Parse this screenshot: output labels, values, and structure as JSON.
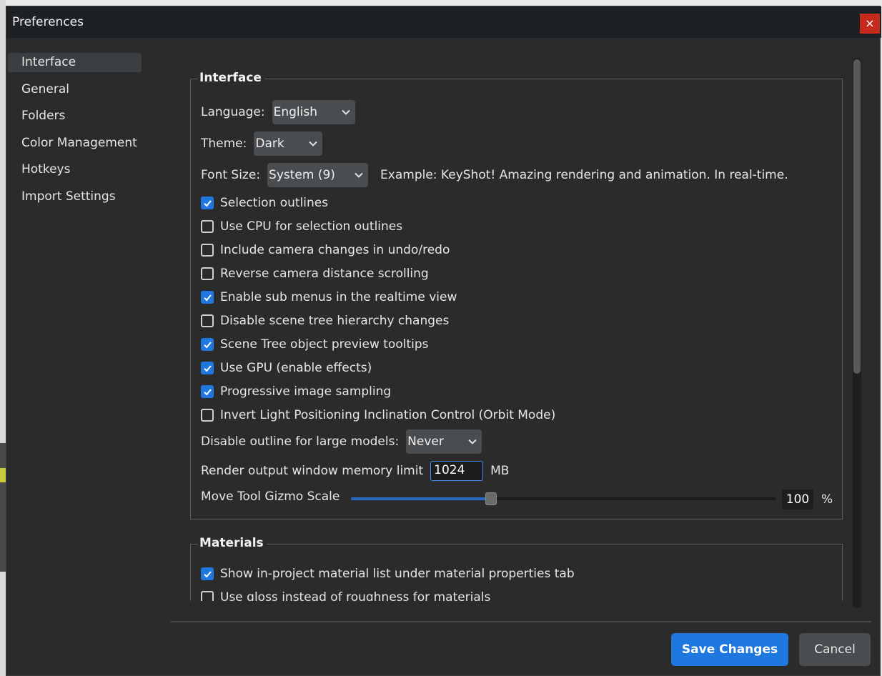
{
  "window": {
    "title": "Preferences",
    "close_glyph": "×"
  },
  "sidebar": {
    "items": [
      {
        "label": "Interface",
        "active": true
      },
      {
        "label": "General"
      },
      {
        "label": "Folders"
      },
      {
        "label": "Color Management"
      },
      {
        "label": "Hotkeys"
      },
      {
        "label": "Import Settings"
      }
    ]
  },
  "interface": {
    "title": "Interface",
    "language": {
      "label": "Language:",
      "value": "English"
    },
    "theme": {
      "label": "Theme:",
      "value": "Dark"
    },
    "font_size": {
      "label": "Font Size:",
      "value": "System (9)",
      "example": "Example: KeyShot! Amazing rendering and animation. In real-time."
    },
    "checkboxes": [
      {
        "label": "Selection outlines",
        "checked": true
      },
      {
        "label": "Use CPU for selection outlines",
        "checked": false
      },
      {
        "label": "Include camera changes in undo/redo",
        "checked": false
      },
      {
        "label": "Reverse camera distance scrolling",
        "checked": false
      },
      {
        "label": "Enable sub menus in the realtime view",
        "checked": true
      },
      {
        "label": "Disable scene tree hierarchy changes",
        "checked": false
      },
      {
        "label": "Scene Tree object preview tooltips",
        "checked": true
      },
      {
        "label": "Use GPU (enable effects)",
        "checked": true
      },
      {
        "label": "Progressive image sampling",
        "checked": true
      },
      {
        "label": "Invert Light Positioning Inclination Control (Orbit Mode)",
        "checked": false
      }
    ],
    "disable_outline": {
      "label": "Disable outline for large models:",
      "value": "Never"
    },
    "memory_limit": {
      "label": "Render output window memory limit",
      "value": "1024",
      "unit": "MB"
    },
    "gizmo_scale": {
      "label": "Move Tool Gizmo Scale",
      "value": "100",
      "unit": "%",
      "fraction": 0.33
    }
  },
  "materials": {
    "title": "Materials",
    "checkboxes": [
      {
        "label": "Show in-project material list under material properties tab",
        "checked": true
      },
      {
        "label": "Use gloss instead of roughness for materials",
        "checked": false
      }
    ]
  },
  "footer": {
    "save_label": "Save Changes",
    "cancel_label": "Cancel"
  },
  "colors": {
    "accent": "#1f78e0",
    "background": "#2b2b2b",
    "titlebar": "#1e2124",
    "close": "#c42b1c"
  }
}
